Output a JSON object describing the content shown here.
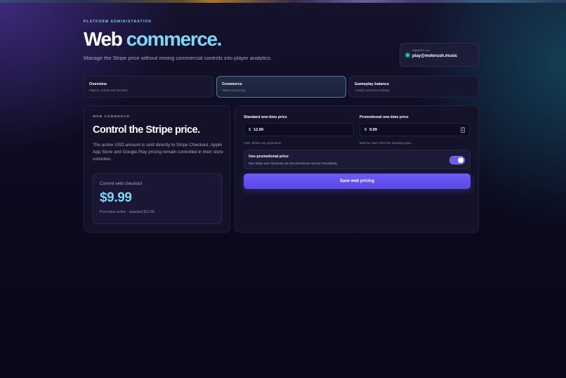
{
  "header": {
    "eyebrow": "PLATFORM ADMINISTRATION",
    "title_main": "Web",
    "title_accent": "commerce.",
    "subtitle": "Manage the Stripe price without mixing commercial controls into player analytics."
  },
  "account": {
    "label": "Signed in as",
    "email": "play@moterush.music",
    "status_color": "#36d399"
  },
  "tabs": [
    {
      "title": "Overview",
      "desc": "Players, activity and retention",
      "active": false
    },
    {
      "title": "Commerce",
      "desc": "Stripe web pricing",
      "active": true
    },
    {
      "title": "Gameplay balance",
      "desc": "Locked curriculum settings",
      "active": false
    }
  ],
  "summary": {
    "eyebrow": "WEB COMMERCE",
    "title": "Control the Stripe price.",
    "description": "The active USD amount is sent directly to Stripe Checkout. Apple App Store and Google Play pricing remain controlled in their store consoles.",
    "checkout_label": "Current web checkout",
    "checkout_price": "$9.99",
    "checkout_note": "Promotion active · standard $12.99"
  },
  "pricing": {
    "currency_symbol": "$",
    "standard": {
      "label": "Standard one-time price",
      "value": "12.99",
      "help": "USD, before any promotion."
    },
    "promotional": {
      "label": "Promotional one-time price",
      "value": "9.99",
      "help": "Must be lower than the standard price."
    },
    "promo_toggle": {
      "title": "Use promotional price",
      "desc": "New Stripe web checkouts use the promotional amount immediately.",
      "enabled": true
    },
    "save_label": "Save web pricing"
  },
  "colors": {
    "accent": "#7fd6f6",
    "primary_button": "#6a5af0"
  }
}
